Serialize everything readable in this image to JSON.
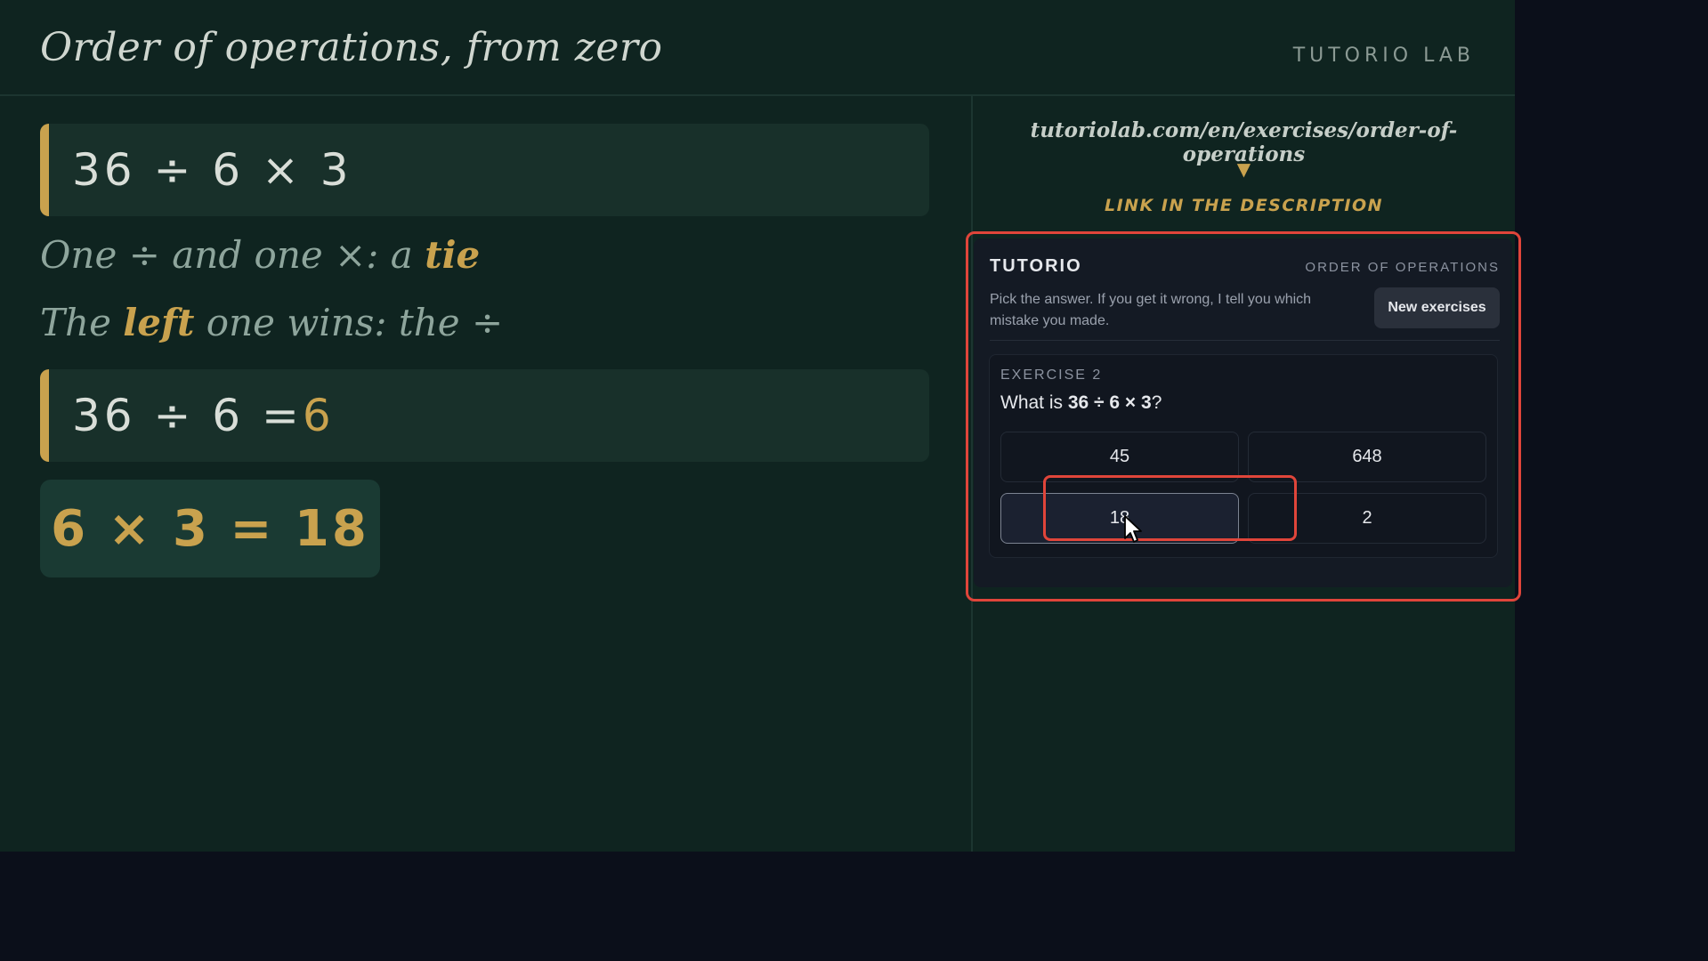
{
  "header": {
    "title": "Order of operations, from zero",
    "brand": "TUTORIO LAB"
  },
  "lesson": {
    "expr1": "36 ÷ 6 × 3",
    "line1_pre": "One ÷ and one ×: a ",
    "line1_hl": "tie",
    "line2_pre": "The ",
    "line2_hl": "left",
    "line2_post": " one wins: the ÷",
    "expr2_pre": "36 ÷ 6 = ",
    "expr2_hl": "6",
    "result": "6 × 3 = 18"
  },
  "link": {
    "url": "tutoriolab.com/en/exercises/order-of-operations",
    "arrow": "▼",
    "caption": "LINK IN THE DESCRIPTION"
  },
  "widget": {
    "brand": "TUTORIO",
    "topic": "ORDER OF OPERATIONS",
    "description": "Pick the answer. If you get it wrong, I tell you which mistake you made.",
    "new_button": "New exercises",
    "exercise": {
      "label": "EXERCISE 2",
      "question_pre": "What is ",
      "question_expr": "36 ÷ 6 × 3",
      "question_post": "?",
      "options": [
        "45",
        "648",
        "18",
        "2"
      ]
    }
  },
  "colors": {
    "accent": "#c9a24e",
    "highlight": "#e0453a",
    "stage_bg": "#0f2420",
    "widget_bg": "#141a24"
  }
}
